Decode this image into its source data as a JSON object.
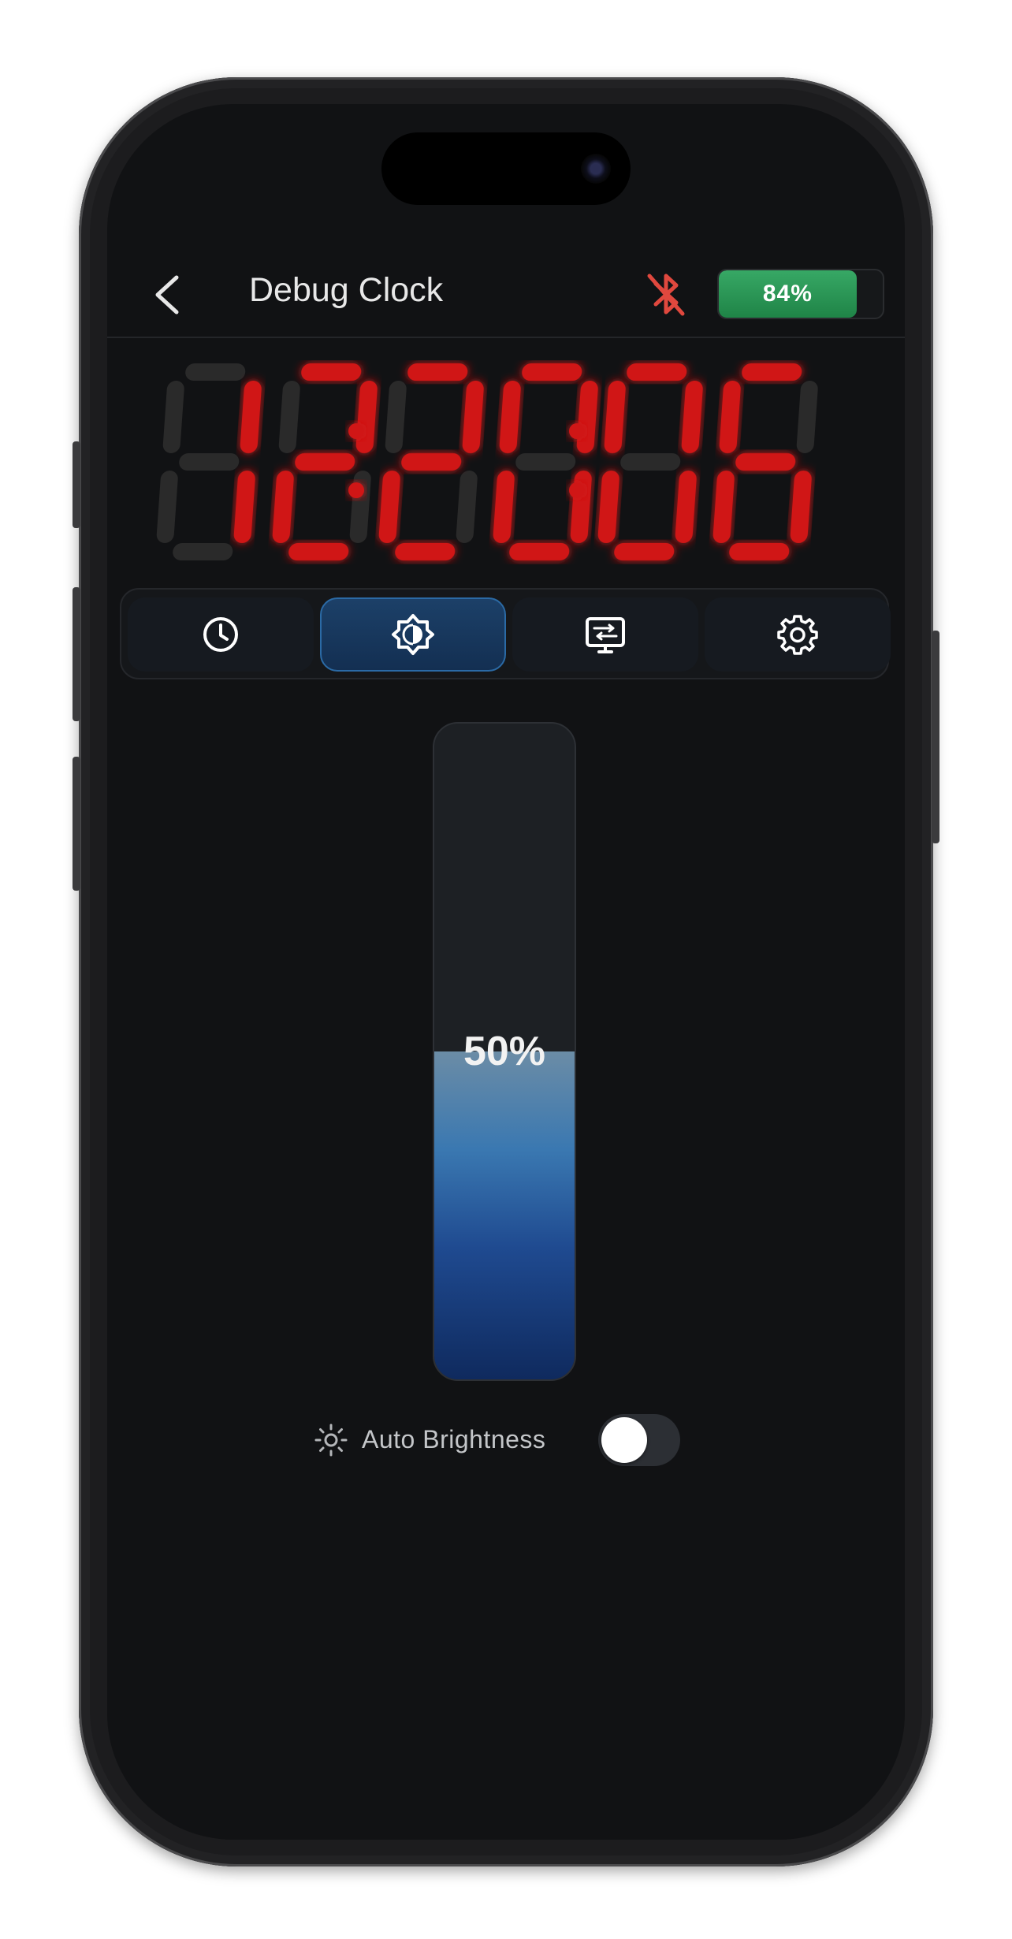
{
  "header": {
    "title": "Debug Clock",
    "back_icon": "chevron-left-icon",
    "bluetooth_icon": "bluetooth-off-icon",
    "bluetooth_color": "#e0483e",
    "battery": {
      "label": "84%",
      "level": 0.84,
      "color": "#2f9a5a"
    }
  },
  "clock": {
    "time": "12:20:06",
    "digits": [
      "1",
      "2",
      "2",
      "0",
      "0",
      "6"
    ],
    "led_color": "#d01818",
    "off_color": "#2a2a2a"
  },
  "tabs": [
    {
      "icon": "clock-icon",
      "active": false
    },
    {
      "icon": "brightness-icon",
      "active": true
    },
    {
      "icon": "display-settings-icon",
      "active": false
    },
    {
      "icon": "gear-icon",
      "active": false
    }
  ],
  "brightness": {
    "label": "50%",
    "value": 0.5
  },
  "auto_brightness": {
    "icon": "sun-icon",
    "label": "Auto Brightness",
    "enabled": false
  },
  "colors": {
    "accent": "#2b6aa5",
    "background": "#111214"
  }
}
